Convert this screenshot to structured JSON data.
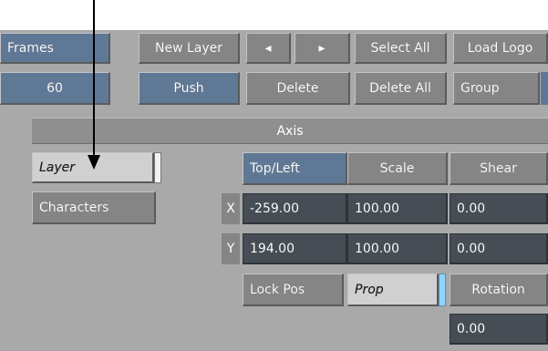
{
  "toolbar": {
    "frames_label": "Frames",
    "frames_value": "60",
    "new_layer": "New Layer",
    "prev_arrow": "◂",
    "next_arrow": "▸",
    "select_all": "Select All",
    "load_logo": "Load Logo",
    "push": "Push",
    "delete": "Delete",
    "delete_all": "Delete All",
    "group": "Group"
  },
  "axis": {
    "title": "Axis",
    "mode_layer": "Layer",
    "mode_characters": "Characters",
    "headers": {
      "top_left": "Top/Left",
      "scale": "Scale",
      "shear": "Shear",
      "rotation": "Rotation"
    },
    "x_label": "X",
    "y_label": "Y",
    "position": {
      "x": "-259.00",
      "y": "194.00"
    },
    "scale": {
      "x": "100.00",
      "y": "100.00"
    },
    "shear": {
      "x": "0.00",
      "y": "0.00"
    },
    "rotation": "0.00",
    "lock_pos": "Lock Pos",
    "prop": "Prop"
  },
  "colors": {
    "panel": "#a9a9a9",
    "button_gray": "#858585",
    "button_blue": "#5f7896",
    "field_dark": "#464d55",
    "indicator": "#8fd3ff"
  }
}
